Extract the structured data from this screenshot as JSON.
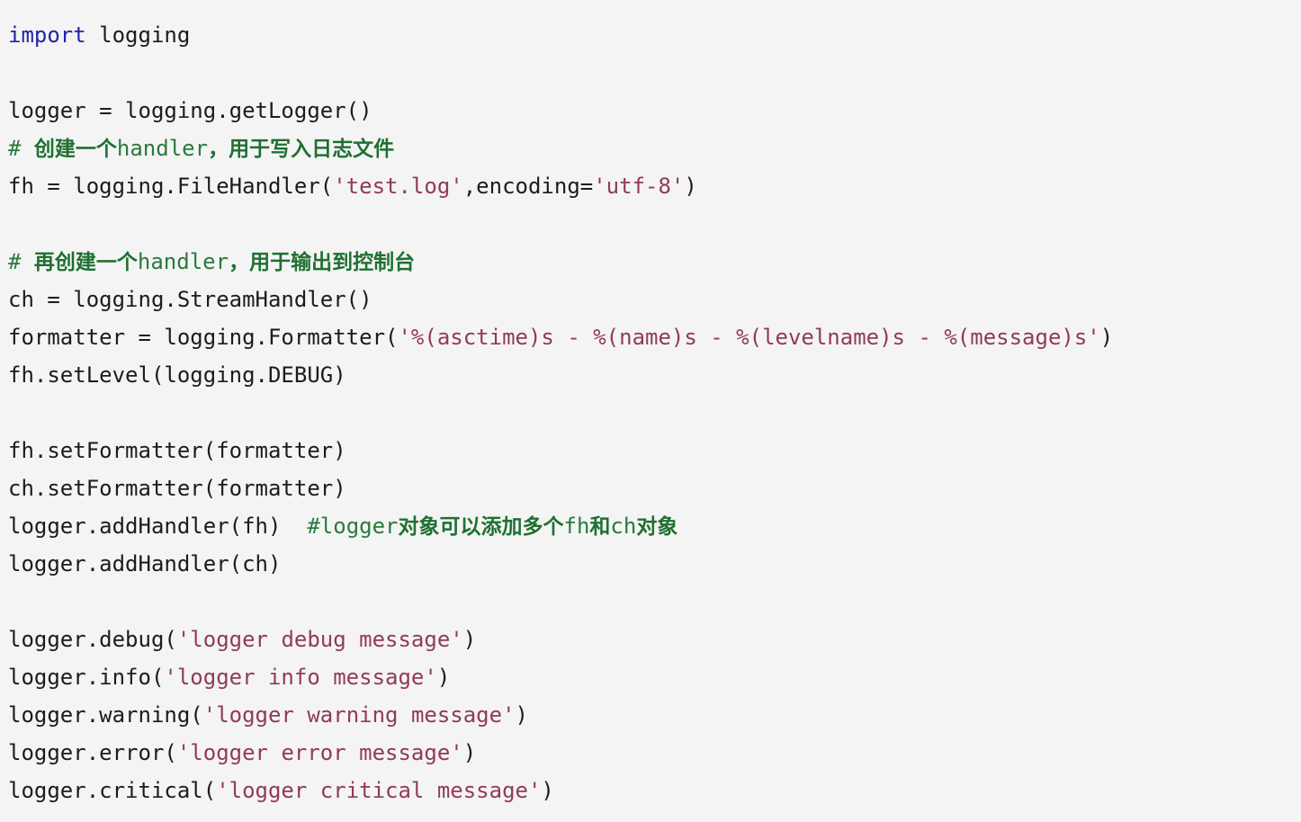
{
  "document": {
    "kind": "python-source-listing",
    "language": "Python",
    "background_color": "#f4f4f4",
    "colors": {
      "text": "#1c1c1c",
      "keyword": "#2222aa",
      "string": "#913b54",
      "comment": "#2a7a3c",
      "comment_cjk": "#1f7032"
    },
    "lines": [
      {
        "index": 1,
        "text": "import logging",
        "tokens": [
          {
            "kind": "keyword",
            "text": "import"
          },
          {
            "kind": "plain",
            "text": " logging"
          }
        ]
      },
      {
        "index": 2,
        "text": "",
        "tokens": []
      },
      {
        "index": 3,
        "text": "logger = logging.getLogger()",
        "tokens": [
          {
            "kind": "plain",
            "text": "logger = logging.getLogger()"
          }
        ]
      },
      {
        "index": 4,
        "text": "# 创建一个handler，用于写入日志文件",
        "tokens": [
          {
            "kind": "comment",
            "text": "# "
          },
          {
            "kind": "comment_cjk",
            "text": "创建一个"
          },
          {
            "kind": "comment",
            "text": "handler"
          },
          {
            "kind": "comment_cjk",
            "text": "，用于写入日志文件"
          }
        ]
      },
      {
        "index": 5,
        "text": "fh = logging.FileHandler('test.log',encoding='utf-8')",
        "tokens": [
          {
            "kind": "plain",
            "text": "fh = logging.FileHandler("
          },
          {
            "kind": "string",
            "text": "'test.log'"
          },
          {
            "kind": "plain",
            "text": ",encoding="
          },
          {
            "kind": "string",
            "text": "'utf-8'"
          },
          {
            "kind": "plain",
            "text": ")"
          }
        ]
      },
      {
        "index": 6,
        "text": "",
        "tokens": []
      },
      {
        "index": 7,
        "text": "# 再创建一个handler，用于输出到控制台",
        "tokens": [
          {
            "kind": "comment",
            "text": "# "
          },
          {
            "kind": "comment_cjk",
            "text": "再创建一个"
          },
          {
            "kind": "comment",
            "text": "handler"
          },
          {
            "kind": "comment_cjk",
            "text": "，用于输出到控制台"
          }
        ]
      },
      {
        "index": 8,
        "text": "ch = logging.StreamHandler()",
        "tokens": [
          {
            "kind": "plain",
            "text": "ch = logging.StreamHandler()"
          }
        ]
      },
      {
        "index": 9,
        "text": "formatter = logging.Formatter('%(asctime)s - %(name)s - %(levelname)s - %(message)s')",
        "tokens": [
          {
            "kind": "plain",
            "text": "formatter = logging.Formatter("
          },
          {
            "kind": "string",
            "text": "'%(asctime)s - %(name)s - %(levelname)s - %(message)s'"
          },
          {
            "kind": "plain",
            "text": ")"
          }
        ]
      },
      {
        "index": 10,
        "text": "fh.setLevel(logging.DEBUG)",
        "tokens": [
          {
            "kind": "plain",
            "text": "fh.setLevel(logging.DEBUG)"
          }
        ]
      },
      {
        "index": 11,
        "text": "",
        "tokens": []
      },
      {
        "index": 12,
        "text": "fh.setFormatter(formatter)",
        "tokens": [
          {
            "kind": "plain",
            "text": "fh.setFormatter(formatter)"
          }
        ]
      },
      {
        "index": 13,
        "text": "ch.setFormatter(formatter)",
        "tokens": [
          {
            "kind": "plain",
            "text": "ch.setFormatter(formatter)"
          }
        ]
      },
      {
        "index": 14,
        "text": "logger.addHandler(fh)  #logger对象可以添加多个fh和ch对象",
        "tokens": [
          {
            "kind": "plain",
            "text": "logger.addHandler(fh)  "
          },
          {
            "kind": "comment",
            "text": "#logger"
          },
          {
            "kind": "comment_cjk",
            "text": "对象可以添加多个"
          },
          {
            "kind": "comment",
            "text": "fh"
          },
          {
            "kind": "comment_cjk",
            "text": "和"
          },
          {
            "kind": "comment",
            "text": "ch"
          },
          {
            "kind": "comment_cjk",
            "text": "对象"
          }
        ]
      },
      {
        "index": 15,
        "text": "logger.addHandler(ch)",
        "tokens": [
          {
            "kind": "plain",
            "text": "logger.addHandler(ch)"
          }
        ]
      },
      {
        "index": 16,
        "text": "",
        "tokens": []
      },
      {
        "index": 17,
        "text": "logger.debug('logger debug message')",
        "tokens": [
          {
            "kind": "plain",
            "text": "logger.debug("
          },
          {
            "kind": "string",
            "text": "'logger debug message'"
          },
          {
            "kind": "plain",
            "text": ")"
          }
        ]
      },
      {
        "index": 18,
        "text": "logger.info('logger info message')",
        "tokens": [
          {
            "kind": "plain",
            "text": "logger.info("
          },
          {
            "kind": "string",
            "text": "'logger info message'"
          },
          {
            "kind": "plain",
            "text": ")"
          }
        ]
      },
      {
        "index": 19,
        "text": "logger.warning('logger warning message')",
        "tokens": [
          {
            "kind": "plain",
            "text": "logger.warning("
          },
          {
            "kind": "string",
            "text": "'logger warning message'"
          },
          {
            "kind": "plain",
            "text": ")"
          }
        ]
      },
      {
        "index": 20,
        "text": "logger.error('logger error message')",
        "tokens": [
          {
            "kind": "plain",
            "text": "logger.error("
          },
          {
            "kind": "string",
            "text": "'logger error message'"
          },
          {
            "kind": "plain",
            "text": ")"
          }
        ]
      },
      {
        "index": 21,
        "text": "logger.critical('logger critical message')",
        "tokens": [
          {
            "kind": "plain",
            "text": "logger.critical("
          },
          {
            "kind": "string",
            "text": "'logger critical message'"
          },
          {
            "kind": "plain",
            "text": ")"
          }
        ]
      }
    ]
  }
}
